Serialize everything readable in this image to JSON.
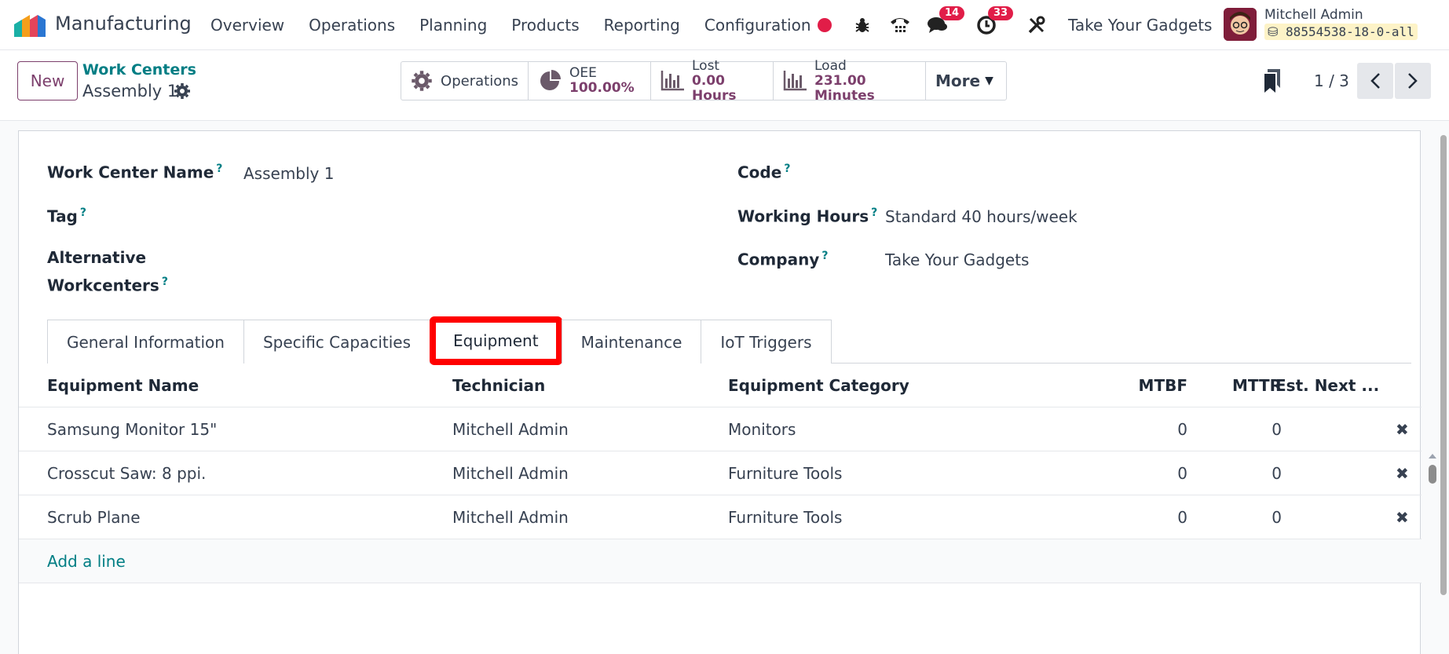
{
  "app": {
    "name": "Manufacturing"
  },
  "menu": [
    "Overview",
    "Operations",
    "Planning",
    "Products",
    "Reporting",
    "Configuration"
  ],
  "systray": {
    "messages_badge": "14",
    "activities_badge": "33",
    "company": "Take Your Gadgets",
    "user_name": "Mitchell Admin",
    "database": "88554538-18-0-all"
  },
  "control": {
    "new_label": "New",
    "breadcrumb": "Work Centers",
    "record_title": "Assembly 1",
    "smart_buttons": {
      "operations": "Operations",
      "oee_label": "OEE",
      "oee_value": "100.00%",
      "lost_label": "Lost",
      "lost_value": "0.00 Hours",
      "load_label": "Load",
      "load_value": "231.00 Minutes",
      "more": "More"
    },
    "pager": "1 / 3"
  },
  "form": {
    "work_center_name_label": "Work Center Name",
    "work_center_name": "Assembly 1",
    "tag_label": "Tag",
    "alt_label_1": "Alternative",
    "alt_label_2": "Workcenters",
    "code_label": "Code",
    "working_hours_label": "Working Hours",
    "working_hours": "Standard 40 hours/week",
    "company_label": "Company",
    "company": "Take Your Gadgets"
  },
  "tabs": [
    "General Information",
    "Specific Capacities",
    "Equipment",
    "Maintenance",
    "IoT Triggers"
  ],
  "active_tab": "Equipment",
  "equipment": {
    "columns": [
      "Equipment Name",
      "Technician",
      "Equipment Category",
      "MTBF",
      "MTTR",
      "Est. Next ..."
    ],
    "rows": [
      [
        "Samsung Monitor 15\"",
        "Mitchell Admin",
        "Monitors",
        "0",
        "0"
      ],
      [
        "Crosscut Saw: 8 ppi.",
        "Mitchell Admin",
        "Furniture Tools",
        "0",
        "0"
      ],
      [
        "Scrub Plane",
        "Mitchell Admin",
        "Furniture Tools",
        "0",
        "0"
      ]
    ],
    "add_line": "Add a line"
  },
  "colors": {
    "brand": "#7c3f6c",
    "link": "#017e84",
    "badge": "#e11d48",
    "highlight": "#ff0000"
  }
}
